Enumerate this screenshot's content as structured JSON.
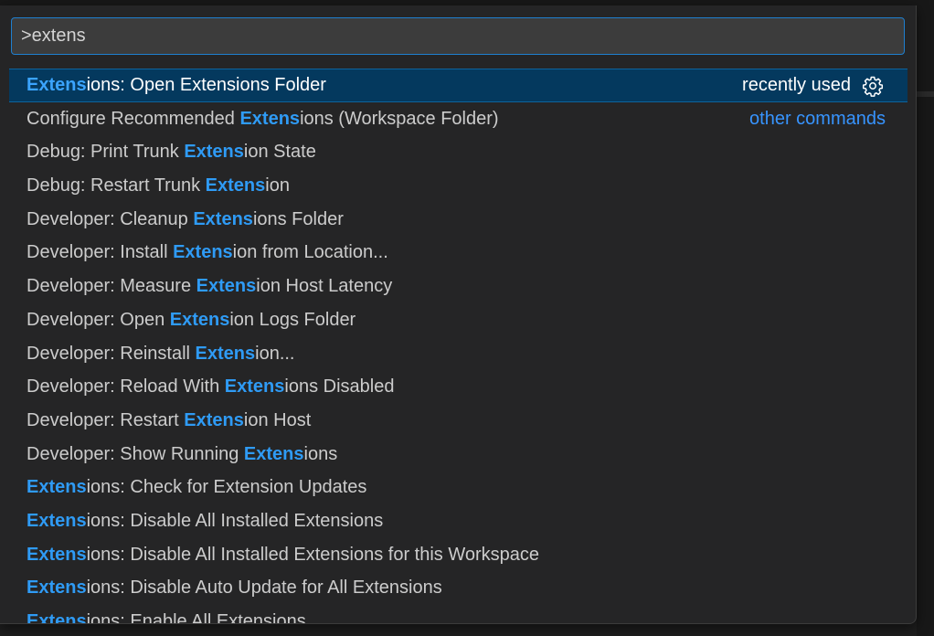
{
  "search": {
    "value": ">extens",
    "placeholder": ""
  },
  "selected_row": {
    "highlight": "Extens",
    "after": "ions: Open Extensions Folder",
    "meta_label": "recently used"
  },
  "second_row": {
    "before": "Configure Recommended ",
    "highlight": "Extens",
    "after": "ions (Workspace Folder)",
    "group_label": "other commands"
  },
  "items": [
    {
      "before": "Debug: Print Trunk ",
      "highlight": "Extens",
      "after": "ion State"
    },
    {
      "before": "Debug: Restart Trunk ",
      "highlight": "Extens",
      "after": "ion"
    },
    {
      "before": "Developer: Cleanup ",
      "highlight": "Extens",
      "after": "ions Folder"
    },
    {
      "before": "Developer: Install ",
      "highlight": "Extens",
      "after": "ion from Location..."
    },
    {
      "before": "Developer: Measure ",
      "highlight": "Extens",
      "after": "ion Host Latency"
    },
    {
      "before": "Developer: Open ",
      "highlight": "Extens",
      "after": "ion Logs Folder"
    },
    {
      "before": "Developer: Reinstall ",
      "highlight": "Extens",
      "after": "ion..."
    },
    {
      "before": "Developer: Reload With ",
      "highlight": "Extens",
      "after": "ions Disabled"
    },
    {
      "before": "Developer: Restart ",
      "highlight": "Extens",
      "after": "ion Host"
    },
    {
      "before": "Developer: Show Running ",
      "highlight": "Extens",
      "after": "ions"
    },
    {
      "before": "",
      "highlight": "Extens",
      "after": "ions: Check for Extension Updates"
    },
    {
      "before": "",
      "highlight": "Extens",
      "after": "ions: Disable All Installed Extensions"
    },
    {
      "before": "",
      "highlight": "Extens",
      "after": "ions: Disable All Installed Extensions for this Workspace"
    },
    {
      "before": "",
      "highlight": "Extens",
      "after": "ions: Disable Auto Update for All Extensions"
    },
    {
      "before": "",
      "highlight": "Extens",
      "after": "ions: Enable All Extensions"
    }
  ],
  "icons": {
    "gear": "gear-icon"
  },
  "colors": {
    "highlight": "#2f9bf5",
    "selection_bg": "#04395e",
    "focus_border": "#1f7fcf",
    "link": "#3794ff"
  }
}
